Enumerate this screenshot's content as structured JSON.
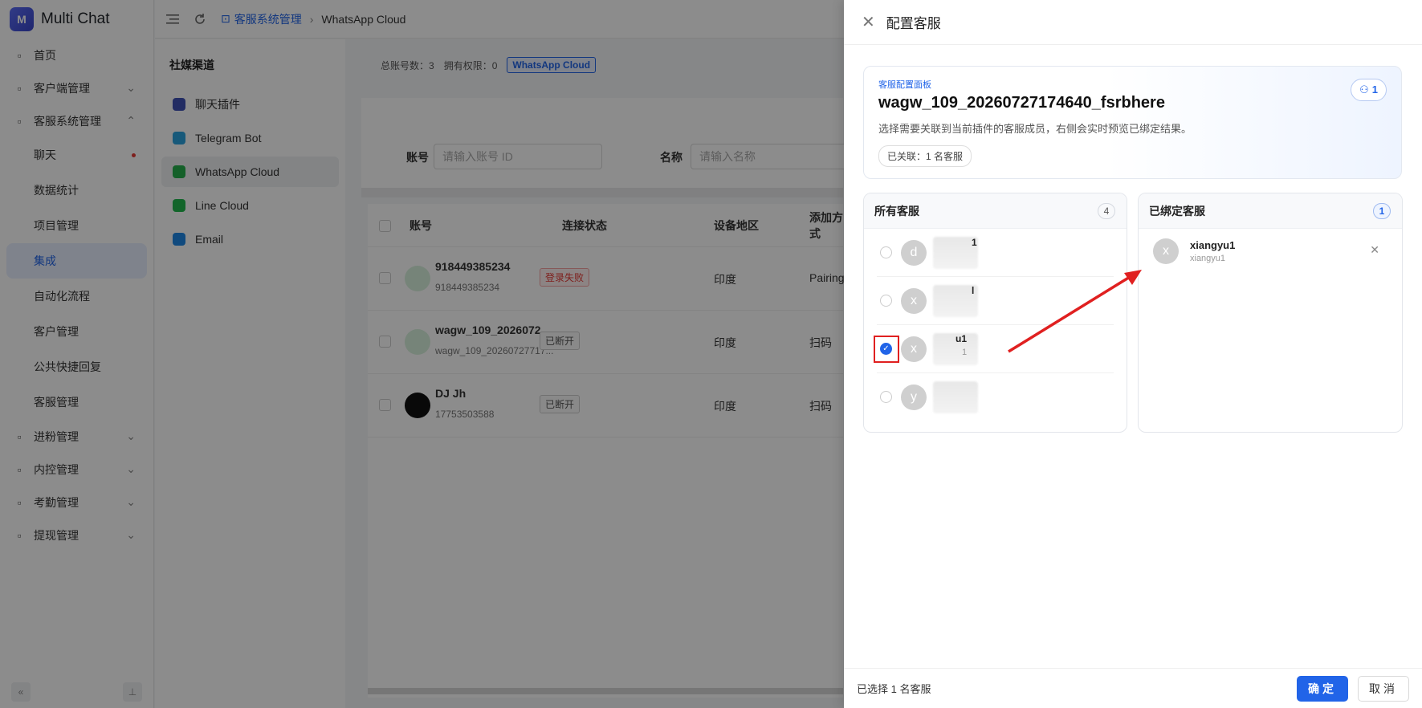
{
  "app": {
    "name": "Multi Chat",
    "logo_letter": "M"
  },
  "sidebar": {
    "items": [
      {
        "label": "首页",
        "icon": "grid-icon"
      },
      {
        "label": "客户端管理",
        "icon": "user-icon",
        "expand": true
      },
      {
        "label": "客服系统管理",
        "icon": "robot-icon",
        "expand": true,
        "open": true
      },
      {
        "label": "聊天",
        "sub": true,
        "dot": true
      },
      {
        "label": "数据统计",
        "sub": true
      },
      {
        "label": "项目管理",
        "sub": true
      },
      {
        "label": "集成",
        "sub": true,
        "active": true
      },
      {
        "label": "自动化流程",
        "sub": true
      },
      {
        "label": "客户管理",
        "sub": true
      },
      {
        "label": "公共快捷回复",
        "sub": true
      },
      {
        "label": "客服管理",
        "sub": true
      },
      {
        "label": "进粉管理",
        "icon": "user-plus-icon",
        "expand": true
      },
      {
        "label": "内控管理",
        "icon": "shield-icon",
        "expand": true
      },
      {
        "label": "考勤管理",
        "icon": "calendar-icon",
        "expand": true
      },
      {
        "label": "提现管理",
        "icon": "wallet-icon",
        "expand": true
      }
    ]
  },
  "breadcrumb": {
    "parent": "客服系统管理",
    "current": "WhatsApp Cloud"
  },
  "channels": {
    "title": "社媒渠道",
    "items": [
      {
        "label": "聊天插件",
        "color": "#3f51b5"
      },
      {
        "label": "Telegram Bot",
        "color": "#2aa3df"
      },
      {
        "label": "WhatsApp Cloud",
        "color": "#25b04b",
        "active": true
      },
      {
        "label": "Line Cloud",
        "color": "#21b94e"
      },
      {
        "label": "Email",
        "color": "#1e88e5"
      }
    ]
  },
  "main": {
    "stats": {
      "total": "总账号数：3",
      "perm": "拥有权限：0",
      "tag": "WhatsApp Cloud"
    },
    "filter": {
      "account_label": "账号",
      "account_placeholder": "请输入账号 ID",
      "name_label": "名称",
      "name_placeholder": "请输入名称"
    },
    "columns": [
      "账号",
      "连接状态",
      "设备地区",
      "添加方式"
    ],
    "rows": [
      {
        "name": "918449385234",
        "sub": "918449385234",
        "status": "登录失败",
        "status_type": "red",
        "region": "印度",
        "method": "Pairing"
      },
      {
        "name": "wagw_109_2026072...",
        "sub": "wagw_109_20260727717...",
        "status": "已断开",
        "status_type": "grey",
        "region": "印度",
        "method": "扫码"
      },
      {
        "name": "DJ Jh",
        "sub": "17753503588",
        "status": "已断开",
        "status_type": "grey",
        "region": "印度",
        "method": "扫码"
      }
    ]
  },
  "drawer": {
    "title": "配置客服",
    "card": {
      "kicker": "客服配置面板",
      "heading": "wagw_109_20260727174640_fsrbhere",
      "desc": "选择需要关联到当前插件的客服成员，右侧会实时预览已绑定结果。",
      "pill": "已关联：1 名客服",
      "count": "1"
    },
    "all_agents": {
      "title": "所有客服",
      "count": "4",
      "items": [
        {
          "avatar": "d",
          "name": "1",
          "sub": "",
          "checked": false
        },
        {
          "avatar": "x",
          "name": "l",
          "sub": "",
          "checked": false
        },
        {
          "avatar": "x",
          "name": "u1",
          "sub": "1",
          "checked": true
        },
        {
          "avatar": "y",
          "name": "",
          "sub": "",
          "checked": false
        }
      ]
    },
    "bound_agents": {
      "title": "已绑定客服",
      "count": "1",
      "items": [
        {
          "avatar": "x",
          "name": "xiangyu1",
          "sub": "xiangyu1"
        }
      ]
    },
    "footer": {
      "summary": "已选择 1 名客服",
      "ok": "确定",
      "cancel": "取消"
    }
  }
}
